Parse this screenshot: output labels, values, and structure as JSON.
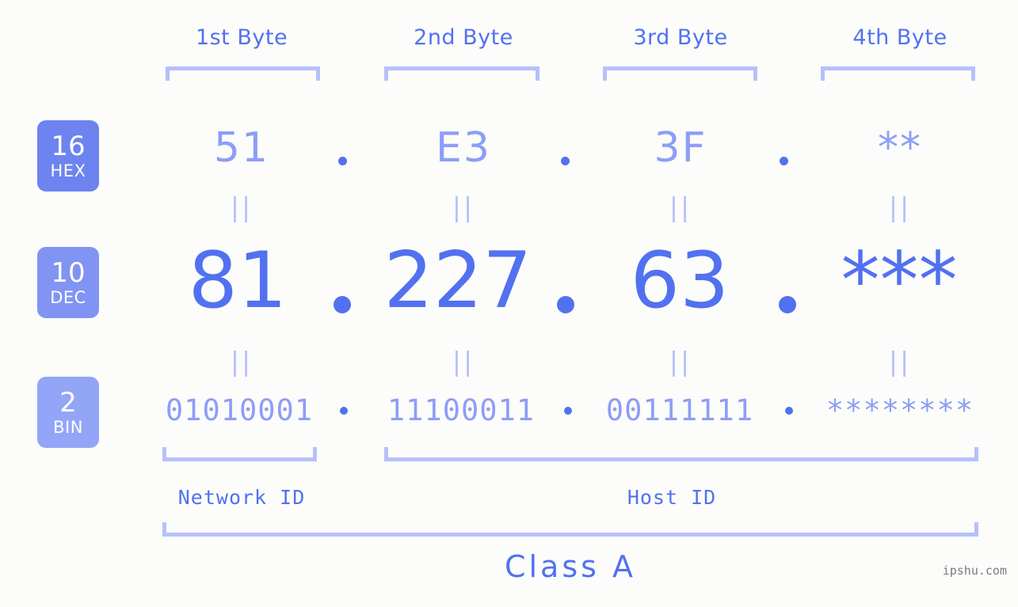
{
  "background_color": "#fcfdfa",
  "accent_color": "#5271f0",
  "accent_light": "#8e9df7",
  "accent_pale": "#b6c0fb",
  "headers": [
    {
      "label": "1st Byte"
    },
    {
      "label": "2nd Byte"
    },
    {
      "label": "3rd Byte"
    },
    {
      "label": "4th Byte"
    }
  ],
  "bases": [
    {
      "num": "16",
      "label": "HEX",
      "color": "#6d83ef"
    },
    {
      "num": "10",
      "label": "DEC",
      "color": "#8194f4"
    },
    {
      "num": "2",
      "label": "BIN",
      "color": "#93a5f7"
    }
  ],
  "rows": {
    "hex": {
      "base": "16",
      "name": "HEX",
      "values": [
        "51",
        "E3",
        "3F",
        "**"
      ]
    },
    "dec": {
      "base": "10",
      "name": "DEC",
      "values": [
        "81",
        "227",
        "63",
        "***"
      ]
    },
    "bin": {
      "base": "2",
      "name": "BIN",
      "values": [
        "01010001",
        "11100011",
        "00111111",
        "********"
      ]
    }
  },
  "separator": ".",
  "equivalence_mark": "||",
  "ranges": {
    "network_id": "Network ID",
    "host_id": "Host ID",
    "class": "Class A"
  },
  "watermark": "ipshu.com"
}
